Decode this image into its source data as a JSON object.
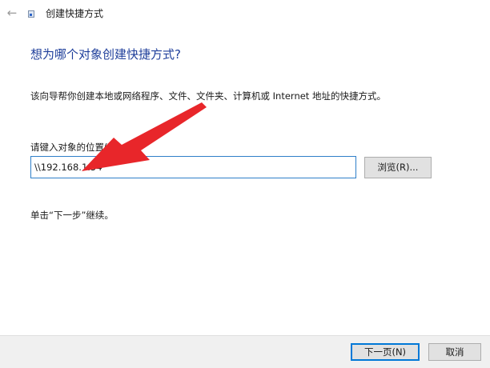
{
  "window": {
    "title": "创建快捷方式",
    "back_icon": "arrow-left-icon",
    "app_icon": "shortcut-icon"
  },
  "page": {
    "heading": "想为哪个对象创建快捷方式?",
    "description": "该向导帮你创建本地或网络程序、文件、文件夹、计算机或 Internet 地址的快捷方式。",
    "field_label": "请键入对象的位置(T):",
    "location_value": "\\\\192.168.1.54",
    "browse_label": "浏览(R)...",
    "hint": "单击“下一步”继续。"
  },
  "annotation": {
    "arrow_color": "#e8262a"
  },
  "footer": {
    "next_label": "下一页(N)",
    "cancel_label": "取消"
  }
}
